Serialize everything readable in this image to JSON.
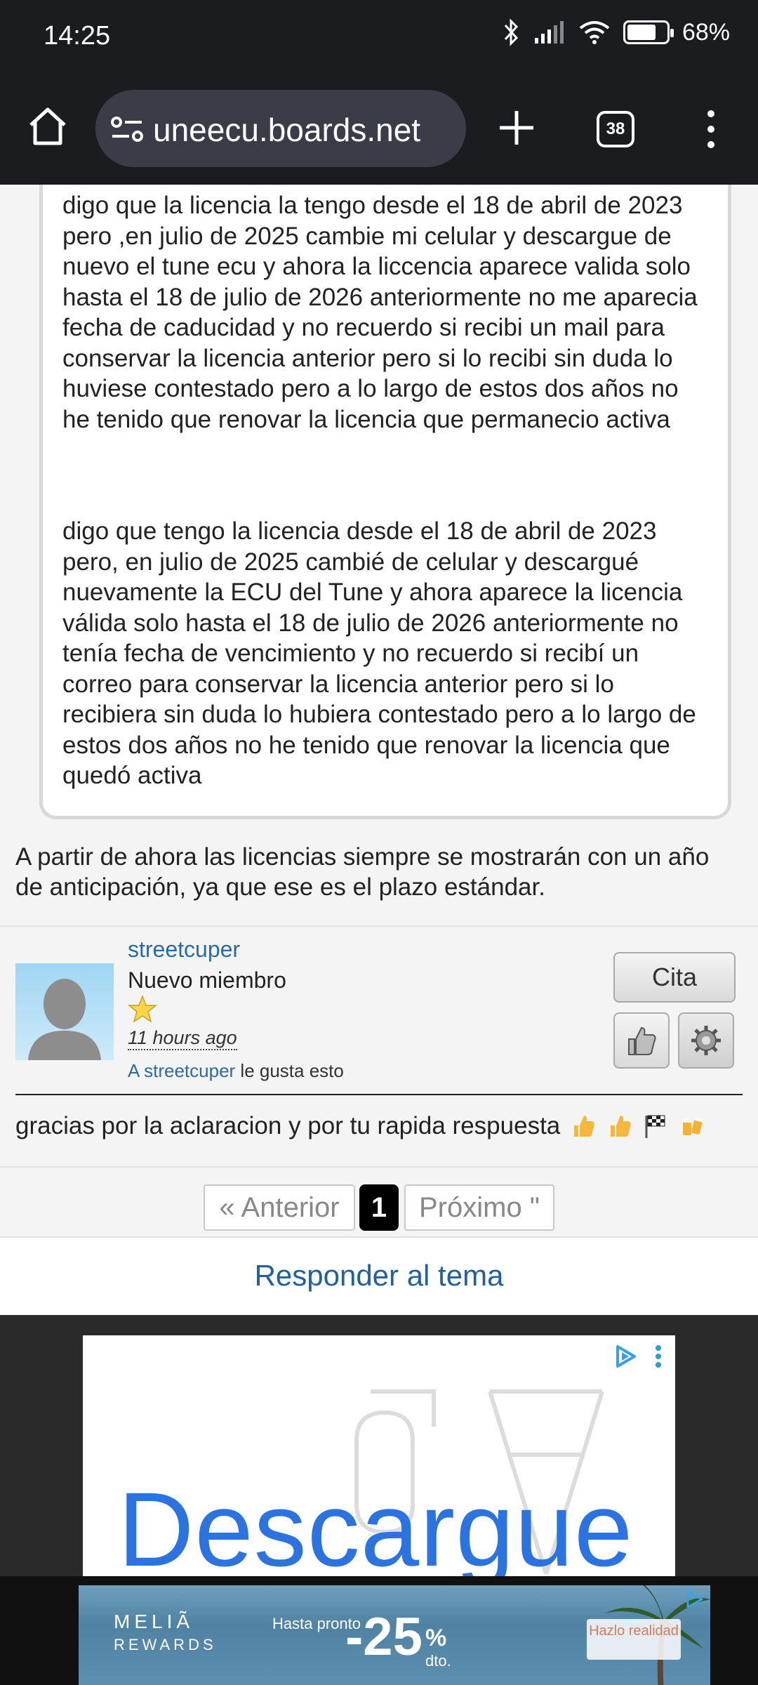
{
  "status_bar": {
    "time": "14:25",
    "battery": "68%",
    "battery_level": 0.68
  },
  "browser": {
    "url": "uneecu.boards.net",
    "tab_count": "38"
  },
  "quote": {
    "paragraph_1": "digo que la licencia la tengo desde el 18 de abril de 2023 pero ,en julio de 2025 cambie mi celular y descargue de nuevo el tune ecu y ahora la liccencia aparece valida solo hasta el 18 de julio de 2026 anteriormente no me aparecia fecha de caducidad y no recuerdo si recibi un mail para conservar la licencia anterior pero si lo recibi sin duda lo huviese contestado pero a lo largo de estos dos años no he tenido que renovar la licencia que permanecio activa",
    "paragraph_2": "digo que tengo la licencia desde el 18 de abril de 2023 pero, en julio de 2025 cambié de celular y descargué nuevamente la ECU del Tune y ahora aparece la licencia válida solo hasta el 18 de julio de 2026 anteriormente no tenía fecha de vencimiento y no recuerdo si recibí un correo para conservar la licencia anterior pero si lo recibiera sin duda lo hubiera contestado pero a lo largo de estos dos años no he tenido que renovar la licencia que quedó activa"
  },
  "note": "A partir de ahora las licencias siempre se mostrarán con un año de anticipación, ya que ese es el plazo estándar.",
  "post": {
    "username": "streetcuper",
    "rank": "Nuevo miembro",
    "time_ago": "11 hours ago",
    "likes_who": "A streetcuper",
    "likes_suffix": " le gusta esto",
    "quote_button": "Cita",
    "text": "gracias por la aclaracion y por tu rapida respuesta"
  },
  "pagination": {
    "prev": "« Anterior",
    "current": "1",
    "next": "Próximo \""
  },
  "reply_button": "Responder al tema",
  "ad": {
    "headline": "Descargue"
  },
  "banner": {
    "brand": "MELIÃ REWARDS",
    "brand_line1": "MELIÃ",
    "brand_line2": "REWARDS",
    "tagline": "Hasta pronto",
    "discount": "-25",
    "percent": "%",
    "percent_suffix": "dto.",
    "cta": "Hazlo realidad"
  },
  "colors": {
    "link": "#2a6aa5",
    "reply": "#1f5fa3",
    "ad_text": "#2a73e0"
  }
}
